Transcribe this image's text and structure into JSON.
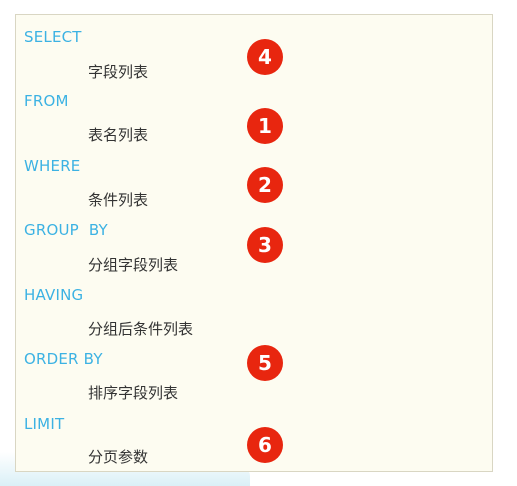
{
  "clauses": [
    {
      "keyword": "SELECT",
      "description": "字段列表",
      "order": "4"
    },
    {
      "keyword": "FROM",
      "description": "表名列表",
      "order": "1"
    },
    {
      "keyword": "WHERE",
      "description": "条件列表",
      "order": "2"
    },
    {
      "keyword": "GROUP  BY",
      "description": "分组字段列表",
      "order": "3"
    },
    {
      "keyword": "HAVING",
      "description": "分组后条件列表",
      "order": ""
    },
    {
      "keyword": "ORDER BY",
      "description": "排序字段列表",
      "order": "5"
    },
    {
      "keyword": "LIMIT",
      "description": "分页参数",
      "order": "6"
    }
  ],
  "colors": {
    "keyword": "#3cb2e3",
    "description": "#333333",
    "badge": "#e8260f",
    "panel": "#fdfcf1"
  }
}
